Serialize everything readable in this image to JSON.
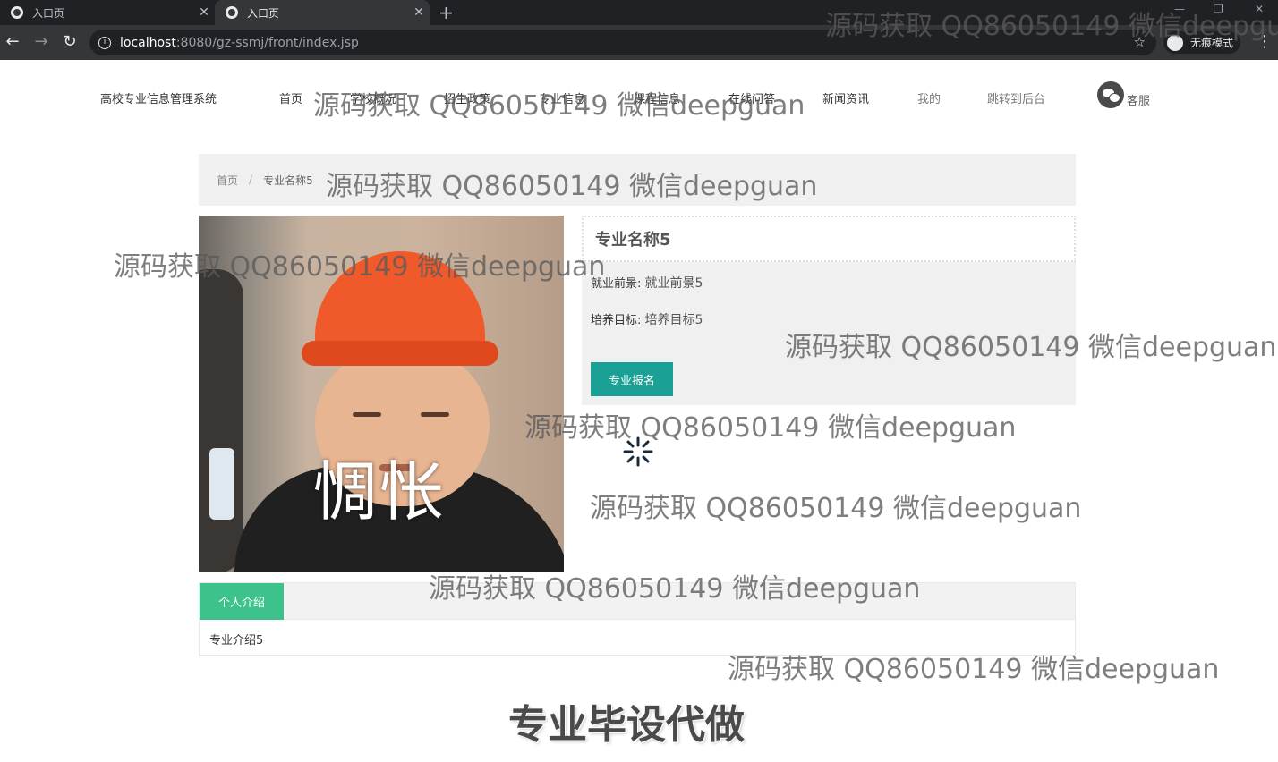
{
  "browser": {
    "tabs": [
      {
        "title": "入口页",
        "active": false
      },
      {
        "title": "入口页",
        "active": true
      }
    ],
    "new_tab": "+",
    "url_host": "localhost",
    "url_path": ":8080/gz-ssmj/front/index.jsp",
    "incognito_label": "无痕模式"
  },
  "header": {
    "brand": "高校专业信息管理系统",
    "nav": [
      "首页",
      "学校概况",
      "招生政策",
      "专业信息",
      "课程信息",
      "在线问答",
      "新闻资讯",
      "我的",
      "跳转到后台"
    ],
    "service_label": "客服"
  },
  "breadcrumb": {
    "home": "首页",
    "separator": "/",
    "current": "专业名称5"
  },
  "photo": {
    "caption": "惆怅"
  },
  "detail": {
    "title": "专业名称5",
    "prospect_label": "就业前景:",
    "prospect_value": "就业前景5",
    "goal_label": "培养目标:",
    "goal_value": "培养目标5",
    "enroll_button": "专业报名"
  },
  "intro": {
    "tab_label": "个人介绍",
    "content": "专业介绍5"
  },
  "watermarks": {
    "text": "源码获取 QQ86050149 微信deepguan",
    "text_cut": "源码获取 QQ86050149 微信deepgua",
    "banner": "专业毕设代做"
  },
  "colors": {
    "accent_teal": "#1aa094",
    "tab_green": "#3dc28b",
    "panel_gray": "#f0f0f0"
  }
}
